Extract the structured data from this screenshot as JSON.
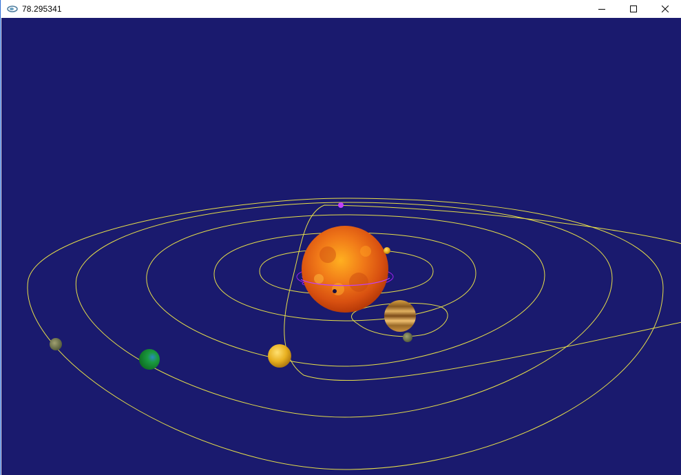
{
  "window": {
    "title": "78.295341",
    "icon": "app-icon",
    "controls": [
      "minimize-icon",
      "maximize-icon",
      "close-icon"
    ]
  },
  "scene": {
    "background_color": "#1a1a6e",
    "orbit_color": "#e8e04a",
    "ring_color": "#a020f0",
    "bodies": [
      "sun",
      "saturn",
      "saturn-moon",
      "jupiter",
      "earth",
      "outer-planet",
      "small-moon",
      "purple-comet",
      "dark-object"
    ]
  }
}
